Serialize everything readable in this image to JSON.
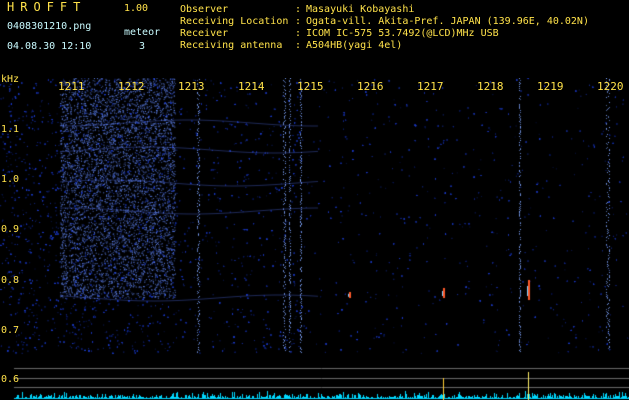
{
  "app": {
    "brand": "HROFFT",
    "version": "1.00"
  },
  "file": {
    "name": "0408301210.png",
    "datetime": "04.08.30 12:10"
  },
  "meteor": {
    "label": "meteor",
    "count": "3"
  },
  "meta": [
    {
      "label": "Observer",
      "value": "Masayuki Kobayashi"
    },
    {
      "label": "Receiving Location",
      "value": "Ogata-vill. Akita-Pref. JAPAN (139.96E, 40.02N)"
    },
    {
      "label": "Receiver",
      "value": "ICOM IC-575 53.7492(@LCD)MHz USB"
    },
    {
      "label": "Receiving antenna",
      "value": "A504HB(yagi 4el)"
    }
  ],
  "meta_separator": ":",
  "axis": {
    "unit": "kHz",
    "freq_ticks": [
      "1.1",
      "1.0",
      "0.9",
      "0.8",
      "0.7",
      "0.6"
    ],
    "minutes": [
      "1211",
      "1212",
      "1213",
      "1214",
      "1215",
      "1216",
      "1217",
      "1218",
      "1219",
      "1220"
    ]
  },
  "colors": {
    "background": "#000000",
    "text": "#ffe24a",
    "header_cyan": "#c9fbff",
    "noise": "#3050ff",
    "baseline": "#00d8ff"
  }
}
